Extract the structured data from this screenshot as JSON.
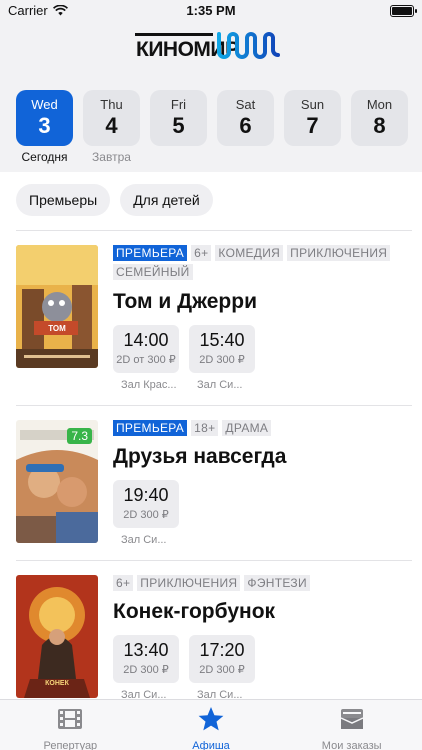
{
  "status_bar": {
    "carrier": "Carrier",
    "time": "1:35 PM"
  },
  "brand": {
    "logo_text": "КИНОМИР",
    "accent": "#1164d8"
  },
  "dates": [
    {
      "dow": "Wed",
      "day": "3",
      "sub": "Сегодня",
      "active": true
    },
    {
      "dow": "Thu",
      "day": "4",
      "sub": "Завтра",
      "active": false
    },
    {
      "dow": "Fri",
      "day": "5",
      "sub": "",
      "active": false
    },
    {
      "dow": "Sat",
      "day": "6",
      "sub": "",
      "active": false
    },
    {
      "dow": "Sun",
      "day": "7",
      "sub": "",
      "active": false
    },
    {
      "dow": "Mon",
      "day": "8",
      "sub": "",
      "active": false
    }
  ],
  "filters": [
    "Премьеры",
    "Для детей"
  ],
  "movies": [
    {
      "title": "Том и Джерри",
      "rating": "",
      "tags": [
        {
          "text": "ПРЕМЬЕРА",
          "premiere": true
        },
        {
          "text": "6+"
        },
        {
          "text": "КОМЕДИЯ"
        },
        {
          "text": "ПРИКЛЮЧЕНИЯ"
        },
        {
          "text": "СЕМЕЙНЫЙ"
        }
      ],
      "sessions": [
        {
          "time": "14:00",
          "format": "2D",
          "price": "от 300 ₽",
          "hall": "Зал Крас..."
        },
        {
          "time": "15:40",
          "format": "2D",
          "price": "300 ₽",
          "hall": "Зал Си..."
        }
      ]
    },
    {
      "title": "Друзья навсегда",
      "rating": "7.3",
      "tags": [
        {
          "text": "ПРЕМЬЕРА",
          "premiere": true
        },
        {
          "text": "18+"
        },
        {
          "text": "ДРАМА"
        }
      ],
      "sessions": [
        {
          "time": "19:40",
          "format": "2D",
          "price": "300 ₽",
          "hall": "Зал Си..."
        }
      ]
    },
    {
      "title": "Конек-горбунок",
      "rating": "",
      "tags": [
        {
          "text": "6+"
        },
        {
          "text": "ПРИКЛЮЧЕНИЯ"
        },
        {
          "text": "ФЭНТЕЗИ"
        }
      ],
      "sessions": [
        {
          "time": "13:40",
          "format": "2D",
          "price": "300 ₽",
          "hall": "Зал Си..."
        },
        {
          "time": "17:20",
          "format": "2D",
          "price": "300 ₽",
          "hall": "Зал Си..."
        }
      ]
    }
  ],
  "tabbar": [
    {
      "label": "Репертуар",
      "icon": "film-icon",
      "active": false
    },
    {
      "label": "Афиша",
      "icon": "star-icon",
      "active": true
    },
    {
      "label": "Мои заказы",
      "icon": "tickets-icon",
      "active": false
    }
  ]
}
